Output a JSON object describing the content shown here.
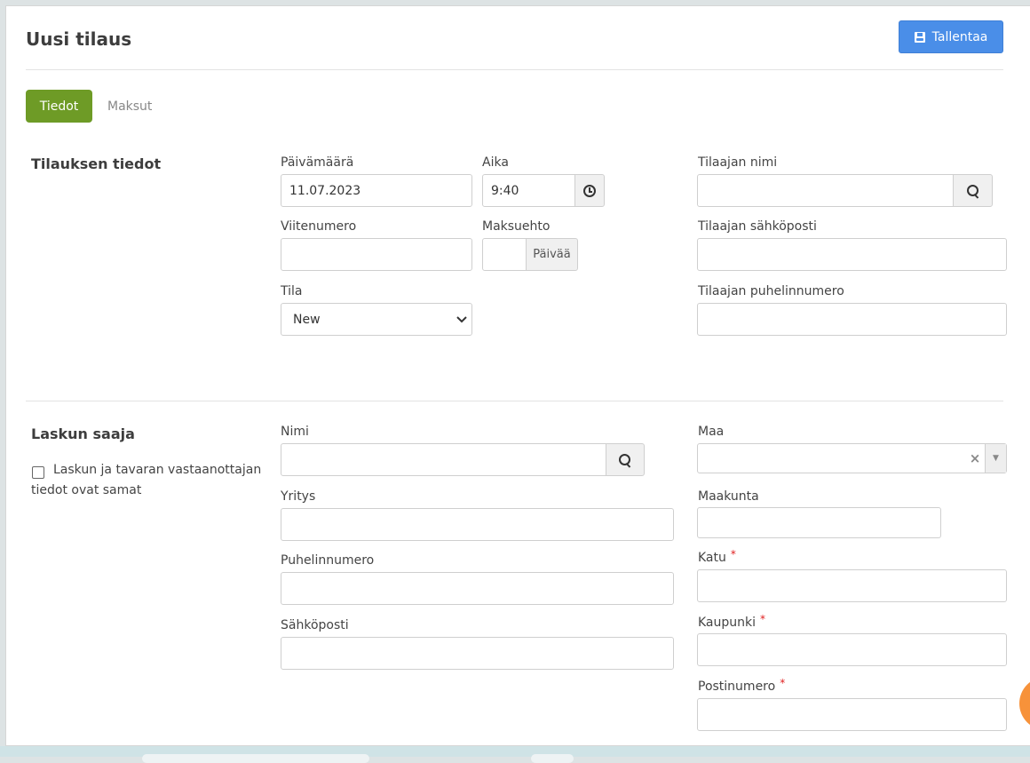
{
  "header": {
    "title": "Uusi tilaus",
    "save_label": "Tallentaa"
  },
  "tabs": [
    {
      "label": "Tiedot",
      "active": true
    },
    {
      "label": "Maksut",
      "active": false
    }
  ],
  "order_details": {
    "section_title": "Tilauksen tiedot",
    "date_label": "Päivämäärä",
    "date_value": "11.07.2023",
    "time_label": "Aika",
    "time_value": "9:40",
    "reference_label": "Viitenumero",
    "reference_value": "",
    "payment_terms_label": "Maksuehto",
    "payment_terms_value": "",
    "payment_terms_unit": "Päivää",
    "status_label": "Tila",
    "status_value": "New",
    "customer_name_label": "Tilaajan nimi",
    "customer_name_value": "",
    "customer_email_label": "Tilaajan sähköposti",
    "customer_email_value": "",
    "customer_phone_label": "Tilaajan puhelinnumero",
    "customer_phone_value": ""
  },
  "billing": {
    "section_title": "Laskun saaja",
    "same_info_line1": "Laskun ja tavaran vastaanottajan",
    "same_info_line2": "tiedot ovat samat",
    "same_info_checked": false,
    "name_label": "Nimi",
    "name_value": "",
    "company_label": "Yritys",
    "company_value": "",
    "phone_label": "Puhelinnumero",
    "phone_value": "",
    "email_label": "Sähköposti",
    "email_value": "",
    "country_label": "Maa",
    "country_value": "",
    "region_label": "Maakunta",
    "region_value": "",
    "street_label": "Katu",
    "street_value": "",
    "city_label": "Kaupunki",
    "city_value": "",
    "postal_label": "Postinumero",
    "postal_value": "",
    "required_mark": "*"
  },
  "icons": {
    "save": "save-icon",
    "search": "search-icon",
    "clock": "clock-icon",
    "clear": "clear-icon",
    "dropdown": "chevron-down-icon"
  },
  "colors": {
    "primary_button": "#4a8ee8",
    "active_tab": "#6e9b26",
    "required": "#e02020",
    "chat_bubble": "#f7923a"
  }
}
